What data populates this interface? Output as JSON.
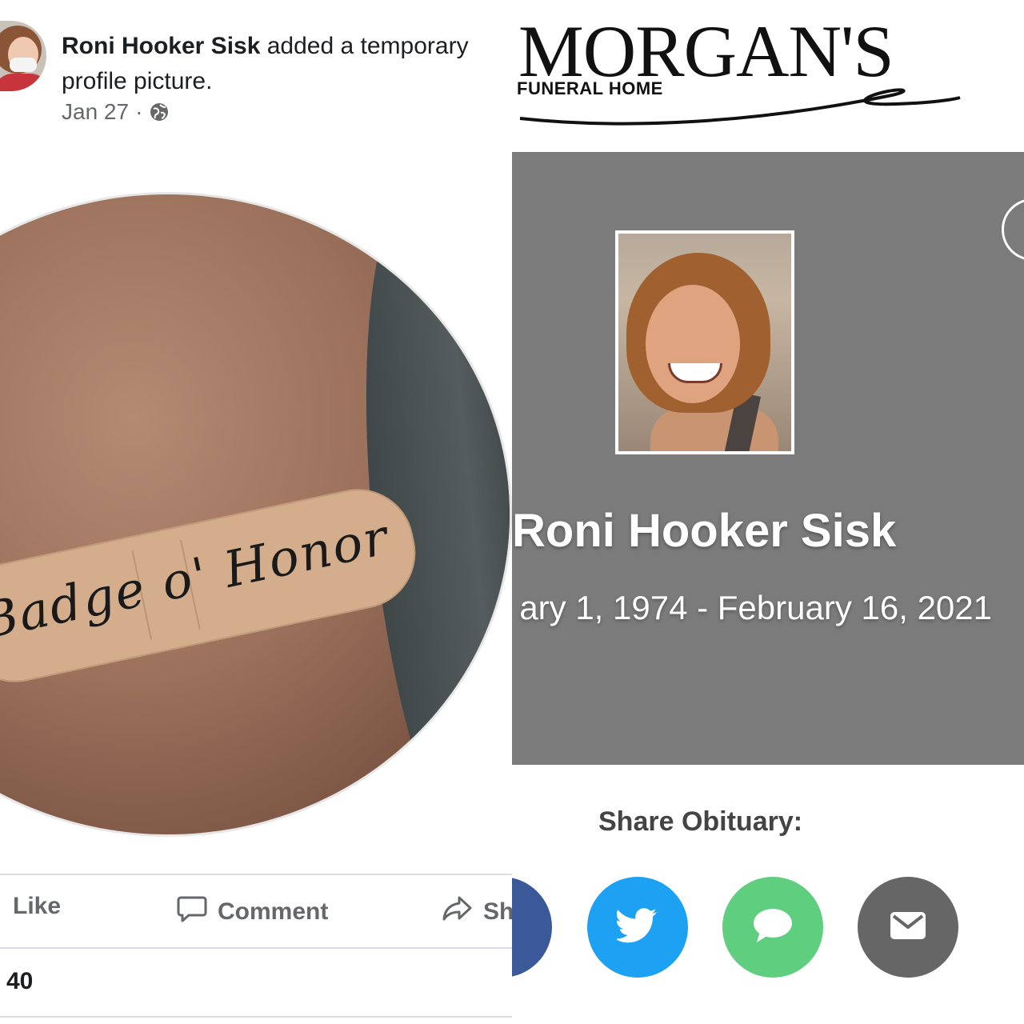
{
  "facebook_post": {
    "author": "Roni Hooker Sisk",
    "action_text": "added a temporary profile picture.",
    "date": "Jan 27",
    "separator": "·",
    "photo_caption": "Badge o' Honor",
    "actions": {
      "like": "Like",
      "comment": "Comment",
      "share": "Sh"
    },
    "reaction_count": "40"
  },
  "funeral_home": {
    "logo_name": "MORGAN'S",
    "logo_subtitle": "FUNERAL HOME",
    "obituary_name": "Roni Hooker Sisk",
    "dates": "ary 1, 1974 - February 16, 2021",
    "share_label": "Share Obituary:",
    "share_buttons": [
      "facebook",
      "twitter",
      "sms",
      "email"
    ],
    "colors": {
      "banner": "#7b7b7b",
      "facebook": "#3b5998",
      "twitter": "#1da1f2",
      "sms": "#5fce7f",
      "email": "#666666"
    }
  }
}
